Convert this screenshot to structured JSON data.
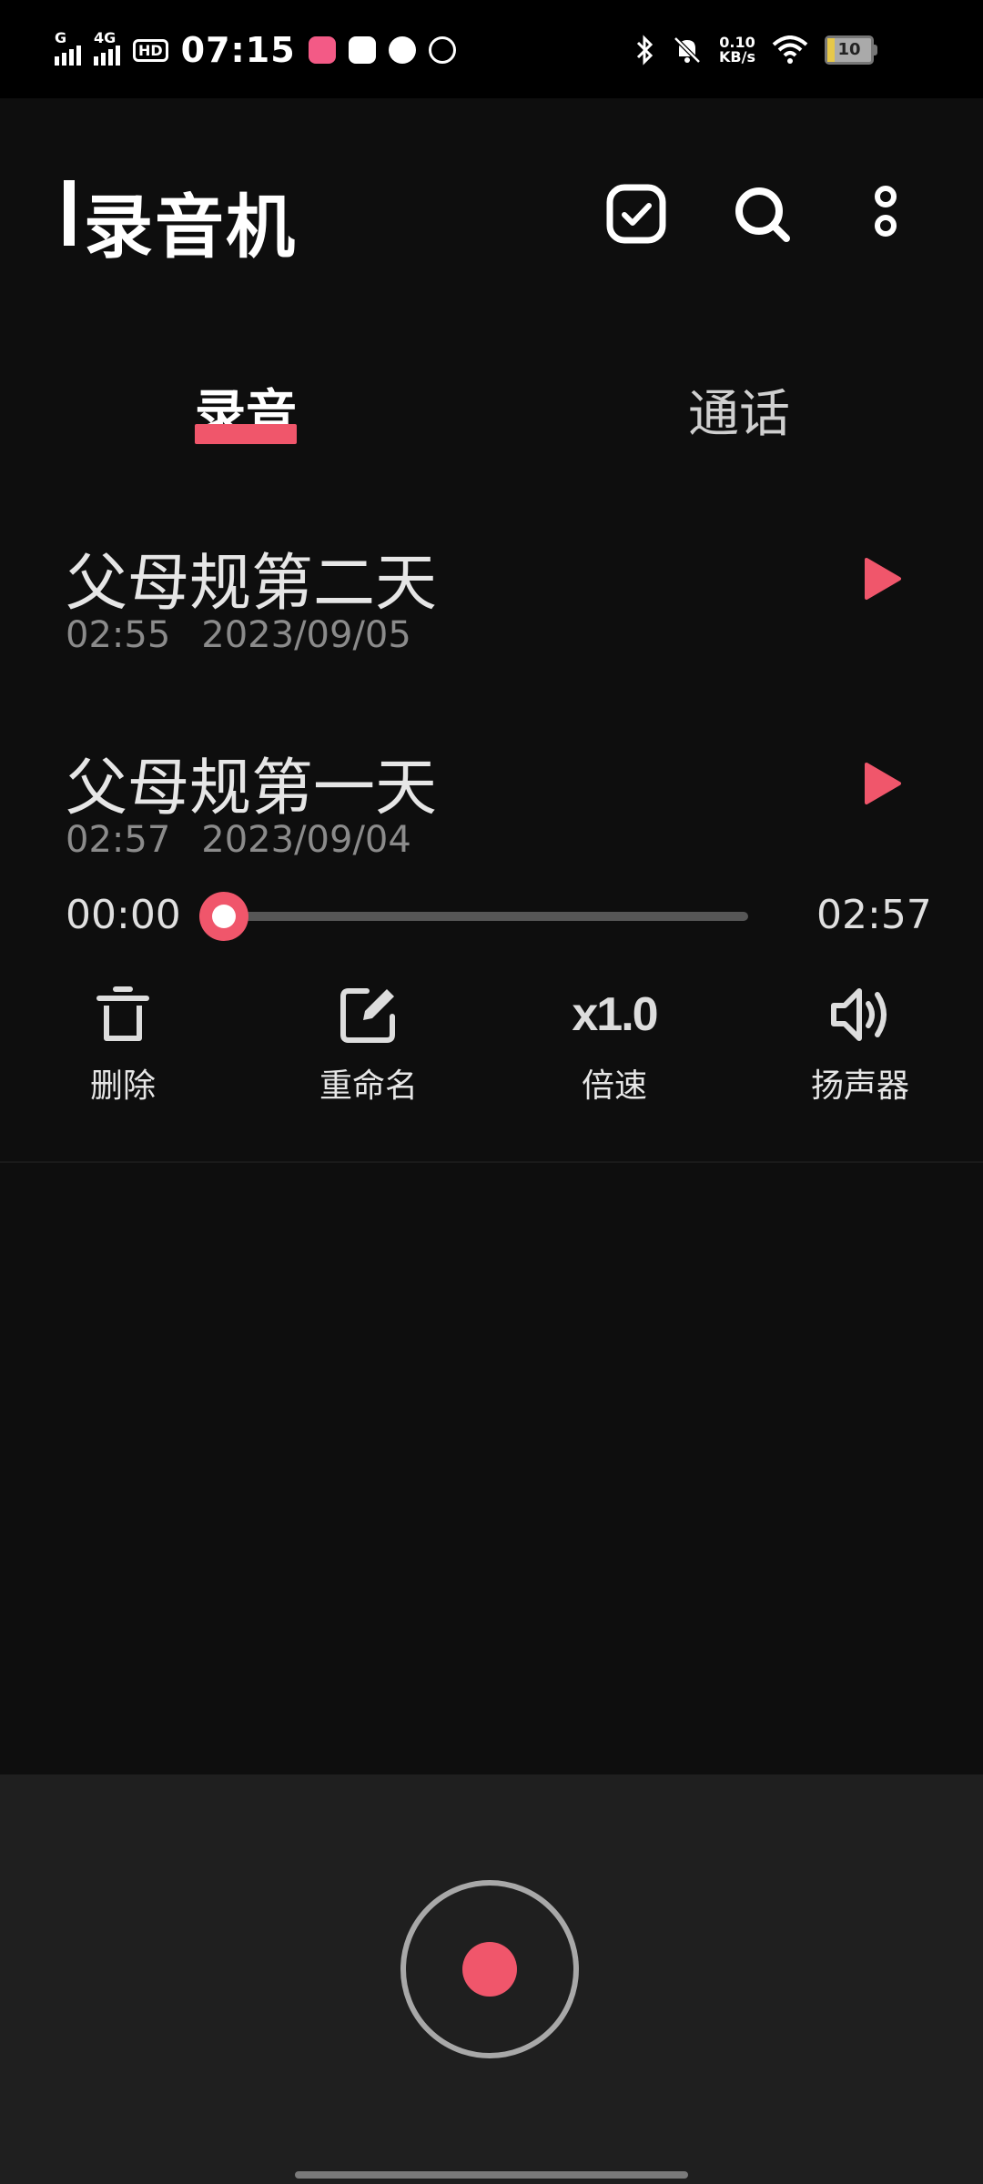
{
  "status_bar": {
    "time": "07:15",
    "signal1_label": "G",
    "signal2_label": "4G",
    "hd_label": "HD",
    "net_speed_value": "0.10",
    "net_speed_unit": "KB/s",
    "battery_level": "10"
  },
  "header": {
    "title": "录音机"
  },
  "tabs": [
    {
      "label": "录音",
      "active": true
    },
    {
      "label": "通话",
      "active": false
    }
  ],
  "recordings": [
    {
      "title": "父母规第二天",
      "duration": "02:55",
      "date": "2023/09/05"
    },
    {
      "title": "父母规第一天",
      "duration": "02:57",
      "date": "2023/09/04"
    }
  ],
  "player": {
    "current_time": "00:00",
    "total_time": "02:57",
    "progress": 0
  },
  "actions": {
    "delete_label": "删除",
    "rename_label": "重命名",
    "speed_label": "倍速",
    "speed_value": "x1.0",
    "speaker_label": "扬声器"
  },
  "colors": {
    "accent": "#f0566b",
    "background": "#0e0e0e",
    "panel": "#1f1f1f"
  }
}
